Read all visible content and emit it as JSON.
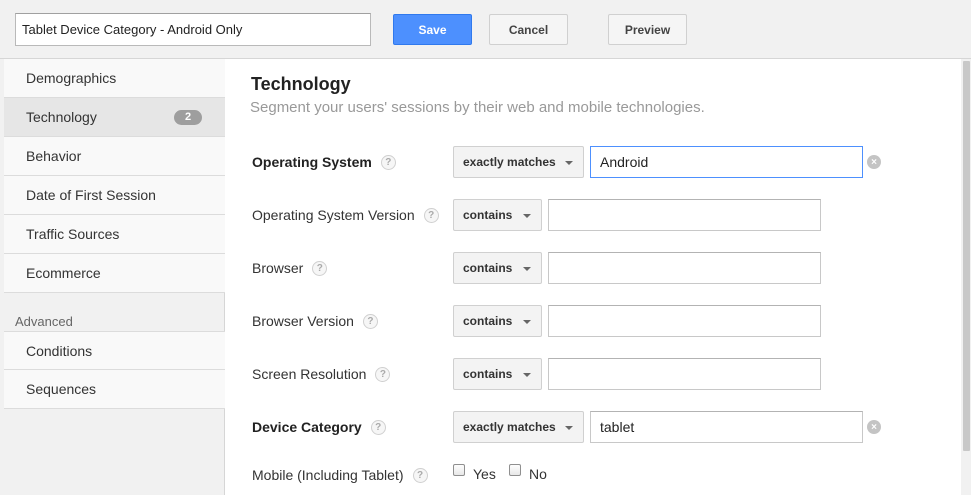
{
  "header": {
    "segment_name": "Tablet Device Category - Android Only",
    "save_label": "Save",
    "cancel_label": "Cancel",
    "preview_label": "Preview"
  },
  "sidebar": {
    "items": [
      {
        "label": "Demographics"
      },
      {
        "label": "Technology",
        "badge": "2",
        "active": true
      },
      {
        "label": "Behavior"
      },
      {
        "label": "Date of First Session"
      },
      {
        "label": "Traffic Sources"
      },
      {
        "label": "Ecommerce"
      }
    ],
    "advanced_label": "Advanced",
    "advanced_items": [
      {
        "label": "Conditions"
      },
      {
        "label": "Sequences"
      }
    ]
  },
  "main": {
    "title": "Technology",
    "subtitle": "Segment your users' sessions by their web and mobile technologies.",
    "help_glyph": "?",
    "clear_glyph": "×",
    "rows": [
      {
        "label": "Operating System",
        "operator": "exactly matches",
        "value": "Android"
      },
      {
        "label": "Operating System Version",
        "operator": "contains",
        "value": ""
      },
      {
        "label": "Browser",
        "operator": "contains",
        "value": ""
      },
      {
        "label": "Browser Version",
        "operator": "contains",
        "value": ""
      },
      {
        "label": "Screen Resolution",
        "operator": "contains",
        "value": ""
      },
      {
        "label": "Device Category",
        "operator": "exactly matches",
        "value": "tablet"
      }
    ],
    "mobile": {
      "label": "Mobile (Including Tablet)",
      "yes_label": "Yes",
      "no_label": "No"
    }
  },
  "colors": {
    "accent": "#4d90fe",
    "sidebar_bg": "#f1f1f1",
    "active_item_bg": "#e6e6e6"
  }
}
